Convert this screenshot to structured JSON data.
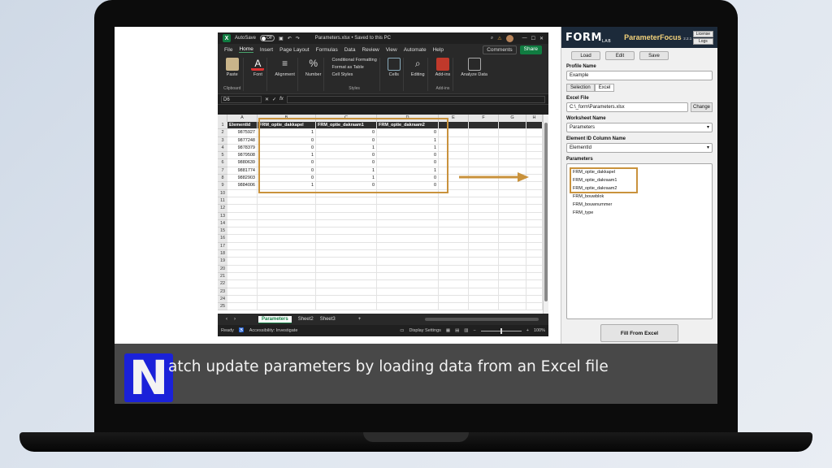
{
  "excel": {
    "autosave_label": "AutoSave",
    "autosave_state": "Off",
    "file_title": "Parameters.xlsx • Saved to this PC",
    "menu": [
      "File",
      "Home",
      "Insert",
      "Page Layout",
      "Formulas",
      "Data",
      "Review",
      "View",
      "Automate",
      "Help"
    ],
    "comments_label": "Comments",
    "share_label": "Share",
    "ribbon": {
      "paste": "Paste",
      "clipboard": "Clipboard",
      "font": "Font",
      "alignment": "Alignment",
      "number": "Number",
      "conditional_formatting": "Conditional Formatting",
      "format_as_table": "Format as Table",
      "cell_styles": "Cell Styles",
      "styles": "Styles",
      "cells": "Cells",
      "editing": "Editing",
      "addins": "Add-ins",
      "addins_group": "Add-ins",
      "analyze_data": "Analyze Data"
    },
    "name_box": "D6",
    "fx": "fx",
    "columns": [
      "A",
      "B",
      "C",
      "D",
      "E",
      "F",
      "G",
      "H"
    ],
    "headers": [
      "ElementId",
      "FRM_optie_dakkapel",
      "FRM_optie_dakraam1",
      "FRM_optie_dakraam2"
    ],
    "rows": [
      [
        "9875927",
        "1",
        "0",
        "0"
      ],
      [
        "9877248",
        "0",
        "0",
        "1"
      ],
      [
        "9878379",
        "0",
        "1",
        "1"
      ],
      [
        "9879508",
        "1",
        "0",
        "0"
      ],
      [
        "9880639",
        "0",
        "0",
        "0"
      ],
      [
        "9881774",
        "0",
        "1",
        "1"
      ],
      [
        "9882903",
        "0",
        "1",
        "0"
      ],
      [
        "9884006",
        "1",
        "0",
        "0"
      ]
    ],
    "row_numbers": [
      "1",
      "2",
      "3",
      "4",
      "5",
      "6",
      "7",
      "8",
      "9",
      "10",
      "11",
      "12",
      "13",
      "14",
      "15",
      "16",
      "17",
      "18",
      "19",
      "20",
      "21",
      "22",
      "23",
      "24",
      "25"
    ],
    "sheets": [
      "Parameters",
      "Sheet2",
      "Sheet3"
    ],
    "status_ready": "Ready",
    "status_accessibility": "Accessibility: Investigate",
    "status_display": "Display Settings",
    "zoom": "100%"
  },
  "pf": {
    "logo": "FORM",
    "logo_sub": "LAB",
    "title": "ParameterFocus",
    "version": "2.2.1",
    "license_btn": "License",
    "logs_btn": "Logs",
    "load": "Load",
    "edit": "Edit",
    "save": "Save",
    "profile_name_label": "Profile Name",
    "profile_name": "Example",
    "seg_selection": "Selection",
    "seg_excel": "Excel",
    "excel_file_label": "Excel File",
    "excel_file": "C:\\_form\\Parameters.xlsx",
    "change": "Change",
    "worksheet_label": "Worksheet Name",
    "worksheet": "Parameters",
    "element_id_label": "Element ID Column Name",
    "element_id": "ElementId",
    "parameters_label": "Parameters",
    "parameters": [
      "FRM_optie_dakkapel",
      "FRM_optie_dakraam1",
      "FRM_optie_dakraam2",
      "FRM_bouwblok",
      "FRM_bouwnummer",
      "FRM_type"
    ],
    "fill_btn": "Fill From Excel"
  },
  "caption": {
    "logo_letter": "N",
    "text": "atch update parameters by loading data from an Excel file"
  },
  "colors": {
    "highlight": "#c9923c",
    "excel_green": "#107c41",
    "pf_header": "#1c2a3a"
  }
}
